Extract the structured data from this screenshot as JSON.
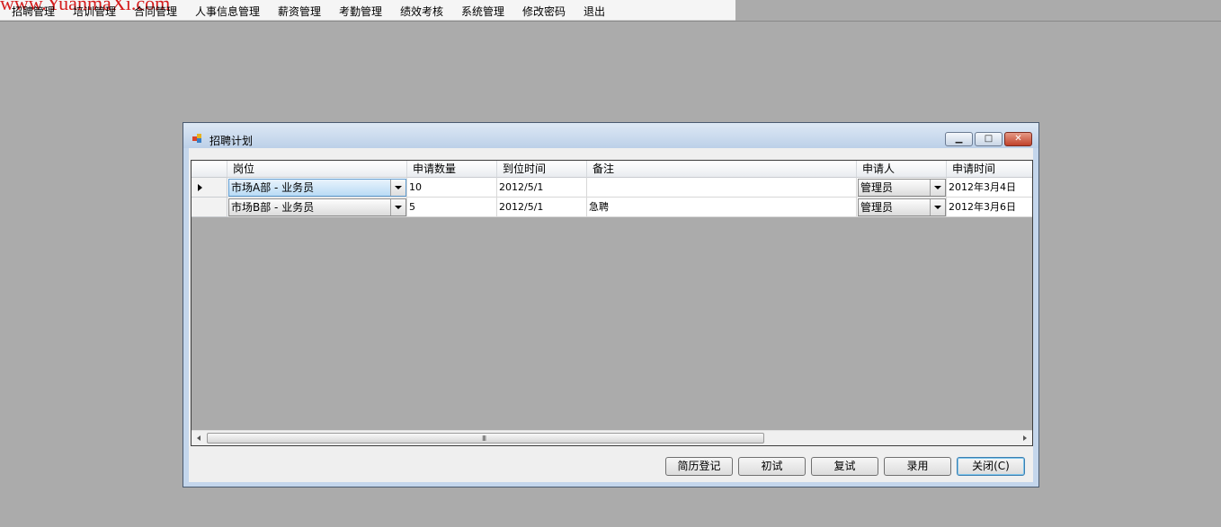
{
  "watermark": "www.YuanmaXi.com",
  "menu": {
    "items": [
      "招聘管理",
      "培训管理",
      "合同管理",
      "人事信息管理",
      "薪资管理",
      "考勤管理",
      "绩效考核",
      "系统管理",
      "修改密码",
      "退出"
    ]
  },
  "window": {
    "title": "招聘计划",
    "minimize_glyph": "▁",
    "maximize_glyph": "□",
    "close_glyph": "✕"
  },
  "grid": {
    "columns": [
      "岗位",
      "申请数量",
      "到位时间",
      "备注",
      "申请人",
      "申请时间"
    ],
    "rows": [
      {
        "position": "市场A部 - 业务员",
        "quantity": "10",
        "arrival": "2012/5/1",
        "remark": "",
        "applicant": "管理员",
        "apply_time": "2012年3月4日",
        "current": true
      },
      {
        "position": "市场B部 - 业务员",
        "quantity": "5",
        "arrival": "2012/5/1",
        "remark": "急聘",
        "applicant": "管理员",
        "apply_time": "2012年3月6日",
        "current": false
      }
    ],
    "scroll_grip": "III"
  },
  "buttons": {
    "resume": "简历登记",
    "first": "初试",
    "second": "复试",
    "hire": "录用",
    "close": "关闭(C)"
  },
  "colors": {
    "desktop": "#ababab",
    "accent": "#3c7fb1",
    "watermark": "#d41c1c"
  }
}
